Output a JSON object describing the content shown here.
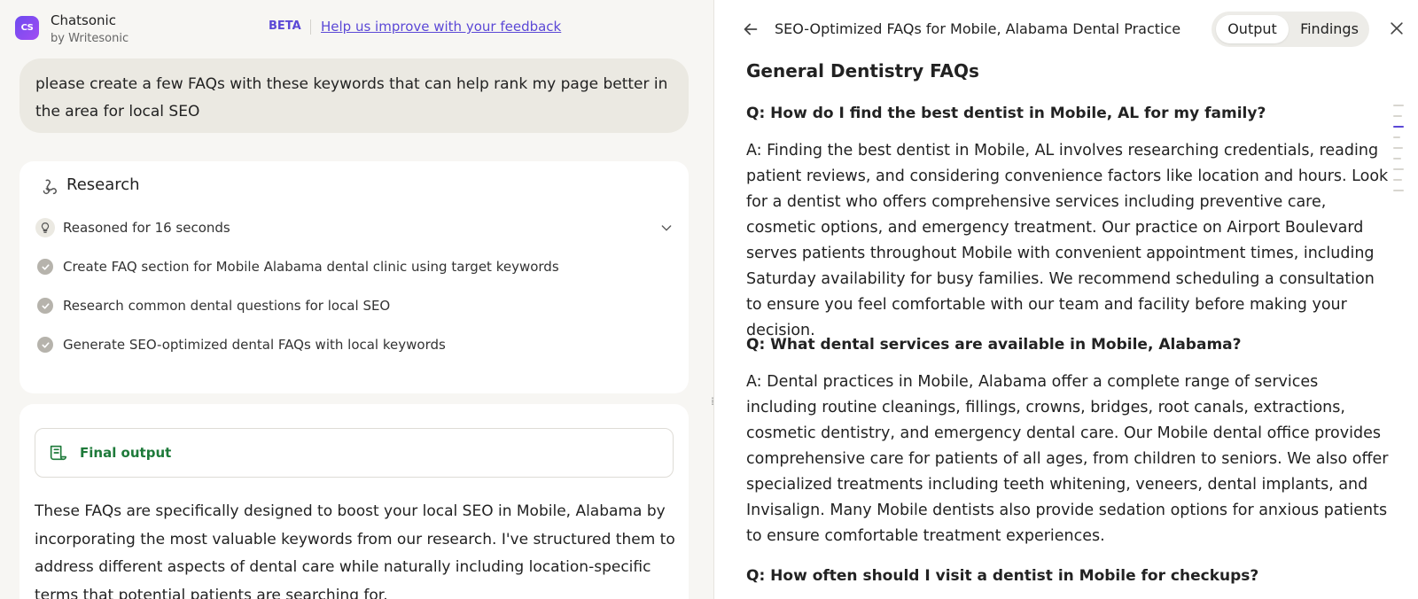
{
  "header": {
    "logo_text": "CS",
    "app_name": "Chatsonic",
    "app_sub": "by Writesonic",
    "beta": "BETA",
    "feedback_link": "Help us improve with your feedback"
  },
  "user_message": "please create a few FAQs with these keywords that can help rank my page better in the area for local SEO",
  "research": {
    "title": "Research",
    "reasoned": "Reasoned for 16 seconds",
    "steps": [
      "Create FAQ section for Mobile Alabama dental clinic using target keywords",
      "Research common dental questions for local SEO",
      "Generate SEO-optimized dental FAQs with local keywords"
    ]
  },
  "final_output": {
    "label": "Final output",
    "text": "These FAQs are specifically designed to boost your local SEO in Mobile, Alabama by incorporating the most valuable keywords from our research. I've structured them to address different aspects of dental care while naturally including location-specific terms that potential patients are searching for."
  },
  "panel": {
    "title": "SEO-Optimized FAQs for Mobile, Alabama Dental Practice",
    "tabs": [
      "Output",
      "Findings"
    ],
    "active_tab": "Output",
    "section_heading": "General Dentistry FAQs",
    "faqs": [
      {
        "q": "Q: How do I find the best dentist in Mobile, AL for my family?",
        "a": "A: Finding the best dentist in Mobile, AL involves researching credentials, reading patient reviews, and considering convenience factors like location and hours. Look for a dentist who offers comprehensive services including preventive care, cosmetic options, and emergency treatment. Our practice on Airport Boulevard serves patients throughout Mobile with convenient appointment times, including Saturday availability for busy families. We recommend scheduling a consultation to ensure you feel comfortable with our team and facility before making your decision."
      },
      {
        "q": "Q: What dental services are available in Mobile, Alabama?",
        "a": "A: Dental practices in Mobile, Alabama offer a complete range of services including routine cleanings, fillings, crowns, bridges, root canals, extractions, cosmetic dentistry, and emergency dental care. Our Mobile dental office provides comprehensive care for patients of all ages, from children to seniors. We also offer specialized treatments including teeth whitening, veneers, dental implants, and Invisalign. Many Mobile dentists also provide sedation options for anxious patients to ensure comfortable treatment experiences."
      },
      {
        "q": "Q: How often should I visit a dentist in Mobile for checkups?",
        "a": ""
      }
    ]
  },
  "colors": {
    "accent": "#5b48d6",
    "final_green": "#1e7a3a",
    "left_bg": "#f7f6f3"
  }
}
